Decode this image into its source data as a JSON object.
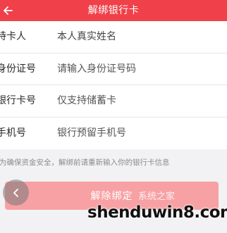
{
  "header": {
    "title": "解绑银行卡",
    "back_icon": "arrow-left-icon"
  },
  "form": {
    "rows": [
      {
        "label": "持卡人",
        "value": "本人真实姓名"
      },
      {
        "label": "身份证号",
        "value": "请输入身份证号码"
      },
      {
        "label": "银行卡号",
        "value": "仅支持储蓄卡"
      },
      {
        "label": "手机号",
        "value": "银行预留手机号"
      }
    ]
  },
  "notice": "为确保资金安全，解绑前请重新输入你的银行卡信息",
  "submit_label": "解除绑定",
  "watermark": "shenduwin8.com",
  "watermark_sub": "系统之家",
  "colors": {
    "accent": "#f0414a",
    "button": "#f7a1a4"
  }
}
